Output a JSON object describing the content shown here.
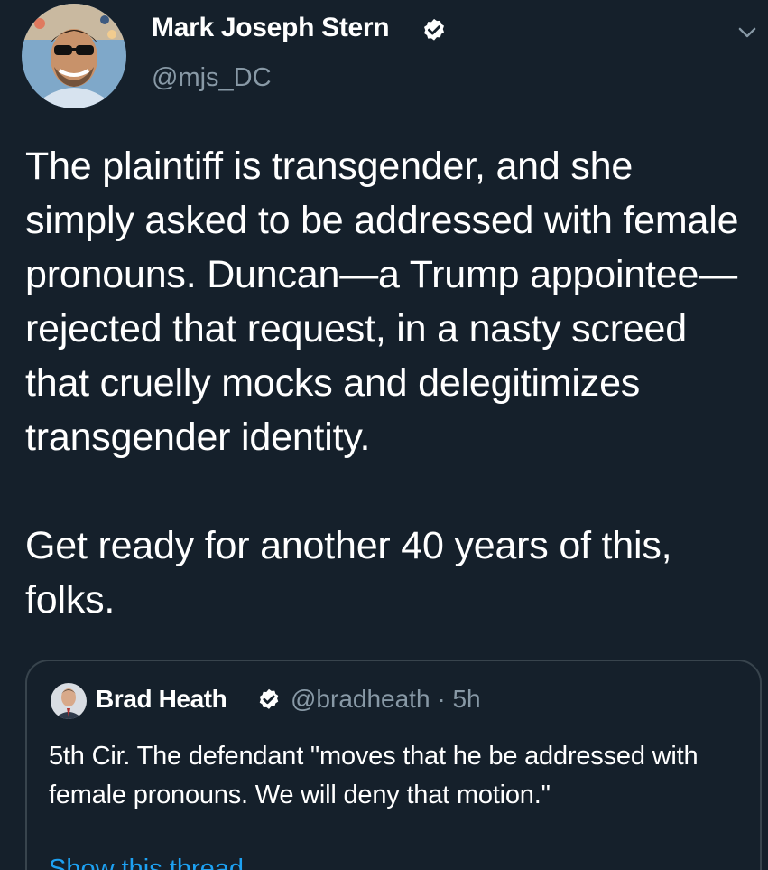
{
  "author": {
    "name": "Mark Joseph Stern",
    "handle": "@mjs_DC"
  },
  "tweet": {
    "paragraphs": [
      "The plaintiff is transgender, and she simply asked to be addressed with female pronouns. Duncan—a Trump appointee—rejected that request, in a nasty screed that cruelly mocks and delegitimizes transgender identity.",
      "Get ready for another 40 years of this, folks."
    ]
  },
  "quoted_tweet": {
    "name": "Brad Heath",
    "handle": "@bradheath",
    "time": "5h",
    "separator": "·",
    "text": "5th Cir. The defendant \"moves that he be addressed with female pronouns. We will deny that motion.\"",
    "thread_link": "Show this thread"
  },
  "icons": {
    "verified": "verified-badge-icon",
    "more": "chevron-down-icon"
  },
  "colors": {
    "background": "#15202b",
    "secondary_text": "#8899a6",
    "accent": "#1da1f2",
    "border": "#38444d"
  }
}
